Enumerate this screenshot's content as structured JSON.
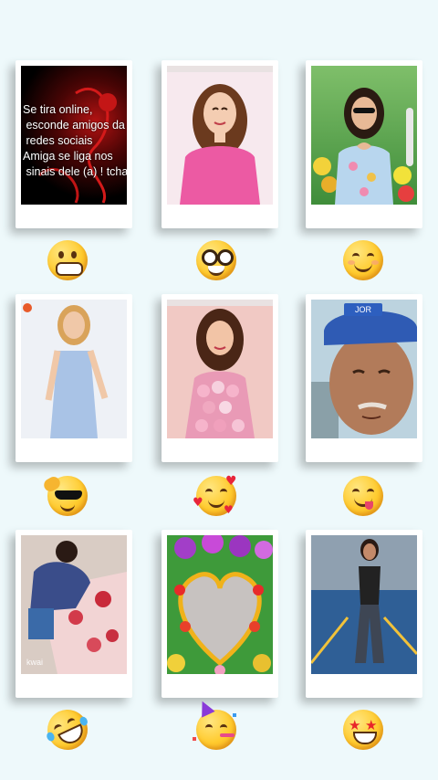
{
  "cards": [
    {
      "id": "card-1",
      "caption": "Se tira online,\n esconde amigos da\n redes sociais\nAmiga se liga nos\n sinais dele (a) ! tchau",
      "reaction": "grimacing-face-icon"
    },
    {
      "id": "card-2",
      "reaction": "nerd-face-icon"
    },
    {
      "id": "card-3",
      "reaction": "smiling-face-icon"
    },
    {
      "id": "card-4",
      "reaction": "saluting-sunglasses-face-icon"
    },
    {
      "id": "card-5",
      "reaction": "smiling-face-with-hearts-icon"
    },
    {
      "id": "card-6",
      "cap_text": "JOR",
      "reaction": "face-savoring-food-icon"
    },
    {
      "id": "card-7",
      "watermark": "kwai",
      "reaction": "rolling-on-floor-laughing-icon"
    },
    {
      "id": "card-8",
      "reaction": "partying-face-icon"
    },
    {
      "id": "card-9",
      "reaction": "star-struck-icon"
    }
  ],
  "colors": {
    "background": "#eef9fb",
    "card": "#ffffff",
    "emoji": "#ffcb2e"
  }
}
